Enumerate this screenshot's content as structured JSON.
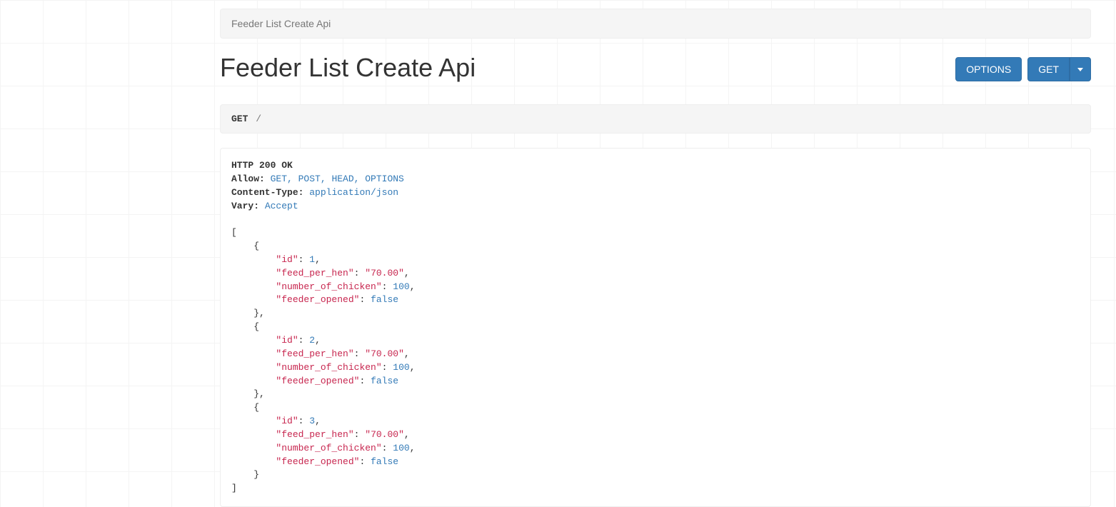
{
  "breadcrumb": "Feeder List Create Api",
  "title": "Feeder List Create Api",
  "buttons": {
    "options": "OPTIONS",
    "get": "GET"
  },
  "request": {
    "method": "GET",
    "path": "/"
  },
  "response": {
    "status_line": "HTTP 200 OK",
    "headers": {
      "Allow": "GET, POST, HEAD, OPTIONS",
      "Content-Type": "application/json",
      "Vary": "Accept"
    },
    "body": [
      {
        "id": 1,
        "feed_per_hen": "70.00",
        "number_of_chicken": 100,
        "feeder_opened": false
      },
      {
        "id": 2,
        "feed_per_hen": "70.00",
        "number_of_chicken": 100,
        "feeder_opened": false
      },
      {
        "id": 3,
        "feed_per_hen": "70.00",
        "number_of_chicken": 100,
        "feeder_opened": false
      }
    ]
  }
}
